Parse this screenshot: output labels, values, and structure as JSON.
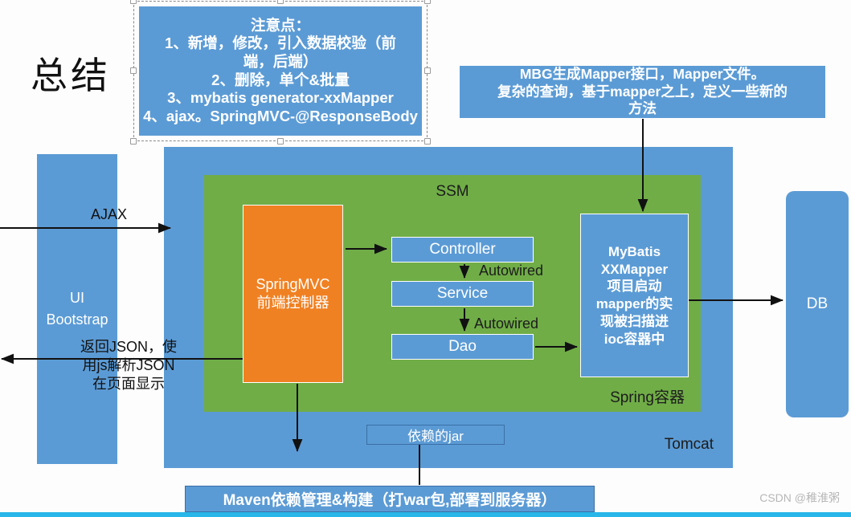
{
  "slide": {
    "title": "总结",
    "watermark": "CSDN @稚淮粥"
  },
  "note_box": {
    "lines": [
      "注意点：",
      "1、新增，修改，引入数据校验（前",
      "端，后端）",
      "2、删除，单个&批量",
      "3、mybatis generator-xxMapper",
      "4、ajax。SpringMVC-@ResponseBody"
    ]
  },
  "mbg_note": {
    "lines": [
      "MBG生成Mapper接口，Mapper文件。",
      "复杂的查询，基于mapper之上，定义一些新的",
      "方法"
    ]
  },
  "containers": {
    "tomcat_label": "Tomcat",
    "ssm_label": "SSM",
    "spring_label": "Spring容器"
  },
  "nodes": {
    "springmvc_line1": "SpringMVC",
    "springmvc_line2": "前端控制器",
    "controller": "Controller",
    "service": "Service",
    "dao": "Dao",
    "mybatis_lines": [
      "MyBatis",
      "XXMapper",
      "项目启动",
      "mapper的实",
      "现被扫描进",
      "ioc容器中"
    ],
    "jar": "依赖的jar",
    "maven": "Maven依赖管理&构建（打war包,部署到服务器）",
    "ui_bootstrap": "UI Bootstrap",
    "db": "DB"
  },
  "edge_labels": {
    "ajax": "AJAX",
    "autowired_1": "Autowired",
    "autowired_2": "Autowired",
    "return_json": "返回JSON，使用js解析JSON在页面显示"
  },
  "colors": {
    "blue": "#5B9BD5",
    "green": "#70AD47",
    "orange": "#F08122",
    "accent_bar": "#29B6E8",
    "text_dark": "#111111",
    "text_light": "#FFFFFF"
  }
}
